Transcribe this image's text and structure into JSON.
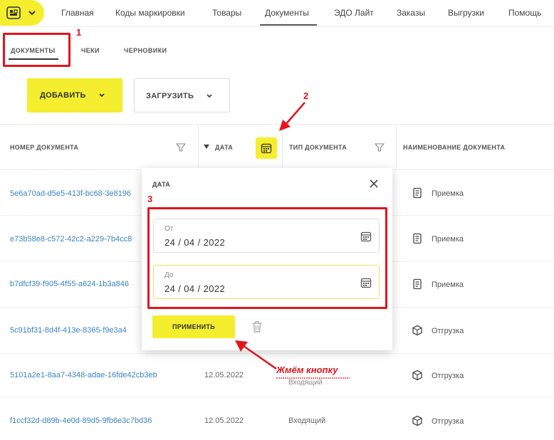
{
  "nav": {
    "items": [
      "Главная",
      "Коды маркировки",
      "Товары",
      "Документы",
      "ЭДО Лайт",
      "Заказы",
      "Выгрузки",
      "Помощь"
    ],
    "active": "Документы"
  },
  "subtabs": [
    "ДОКУМЕНТЫ",
    "ЧЕКИ",
    "ЧЕРНОВИКИ"
  ],
  "toolbar": {
    "add_label": "ДОБАВИТЬ",
    "upload_label": "ЗАГРУЗИТЬ"
  },
  "table": {
    "headers": [
      "НОМЕР ДОКУМЕНТА",
      "ДАТА",
      "ТИП ДОКУМЕНТА",
      "НАИМЕНОВАНИЕ ДОКУМЕНТА"
    ],
    "rows": [
      {
        "number": "5e6a70ad-d5e5-413f-bc68-3e8196",
        "date": "",
        "type": "",
        "name": "Приемка"
      },
      {
        "number": "e73b58e8-c572-42c2-a229-7b4cc8",
        "date": "",
        "type": "",
        "name": "Приемка"
      },
      {
        "number": "b7dfcf39-f905-4f55-a624-1b3a846",
        "date": "",
        "type": "",
        "name": "Приемка"
      },
      {
        "number": "5c91bf31-8d4f-413e-8365-f9e3a4",
        "date": "",
        "type": "",
        "name": "Отгрузка"
      },
      {
        "number": "5101a2e1-8aa7-4348-adae-16fde42cb3eb",
        "date": "12.05.2022",
        "type": "Входящий",
        "name": "Отгрузка"
      },
      {
        "number": "f1ccf32d-d89b-4e0d-89d5-9fb6e3c7bd36",
        "date": "12.05.2022",
        "type": "Входящий",
        "name": "Отгрузка"
      }
    ]
  },
  "popup": {
    "title": "ДАТА",
    "from_label": "От",
    "from_value": "24 / 04 / 2022",
    "to_label": "До",
    "to_value": "24 / 04 / 2022",
    "apply_label": "ПРИМЕНИТЬ"
  },
  "annotations": {
    "num1": "1",
    "num2": "2",
    "num3": "3",
    "note": "Жмём кнопку"
  },
  "colors": {
    "accent": "#f4ee2e",
    "annotation": "#e3141e",
    "link": "#3a84c4"
  }
}
